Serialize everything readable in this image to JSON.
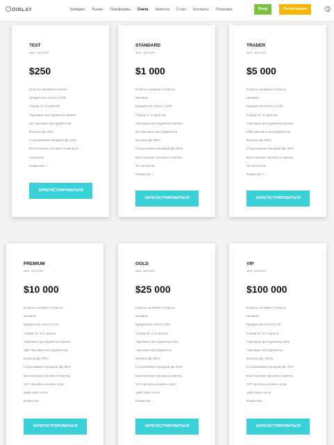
{
  "header": {
    "logo": "OINLAY",
    "nav": [
      "Трейдинг",
      "Рынки",
      "Платформы",
      "Счета",
      "Новости",
      "О нас",
      "Контакты",
      "Политика"
    ],
    "login": "Вход",
    "register": "Регистрация"
  },
  "plans": [
    {
      "name": "TEST",
      "sub": "мин. депозит",
      "price": "$250",
      "features": [
        "Классы активов 9 валют",
        "Кредитное плечо 1:200",
        "Спред от 3 пунктов",
        "Торговые инструменты Более",
        "25 торговых инструментов",
        "Бонусы До 20%",
        "Страхование вкладов До 10%",
        "Бесплатные сигналы в месяц 5",
        "сигналов",
        "Комиссия +"
      ],
      "cta": "ЗАРЕГИСТРИРОВАТЬСЯ"
    },
    {
      "name": "STANDARD",
      "sub": "мин. депозит",
      "price": "$1 000",
      "features": [
        "Классы активов 4 класса",
        "активов",
        "Кредитное плечо 1:200",
        "Спред от 3 пунктов",
        "Торговые инструменты Более",
        "50 торговых инструментов",
        "Бонусы До 35%",
        "Страхование вкладов До 35%",
        "Бесплатные сигналы в месяц",
        "10 сигналов",
        "Комиссия +"
      ],
      "cta": "ЗАРЕГИСТРИРОВАТЬСЯ"
    },
    {
      "name": "TRADER",
      "sub": "мин. депозит",
      "price": "$5 000",
      "features": [
        "Классы активов 4 класса",
        "активов",
        "Кредитное плечо 1:100",
        "Спред От 3 пунктов",
        "Торговые инструменты Более",
        "100 торговых инструментов",
        "Бонусы До 50%",
        "Страхование вкладов До 40%",
        "Бесплатные сигналы в месяц",
        "15 сигналов",
        "Комиссия +"
      ],
      "cta": "ЗАРЕГИСТРИРОВАТЬСЯ"
    },
    {
      "name": "PREMIUM",
      "sub": "мин. депозит",
      "price": "$10 000",
      "features": [
        "Классы активов 4 класса",
        "активов",
        "Кредитное плечо 1:75",
        "Спред От 2.1 пункта",
        "Торговые инструменты Более",
        "250 торговых инструментов",
        "Бонусы До 70%",
        "Страхование вкладов До 55%",
        "Бесплатные сигналы в месяц",
        "VIP сигналы на весь срок",
        "действия счета",
        "Комиссия -"
      ],
      "cta": "ЗАРЕГИСТРИРОВАТЬСЯ"
    },
    {
      "name": "GOLD",
      "sub": "мин. депозит",
      "price": "$25 000",
      "features": [
        "Классы активов 4 класса",
        "активов",
        "Кредитное плечо 1:50",
        "Спред От 1.5 пункта",
        "Торговые инструменты Все",
        "торговые инструменты",
        "Бонусы До 85%",
        "Страхование вкладов До 65%",
        "Бесплатные сигналы в месяц",
        "VIP сигналы на весь срок",
        "действия счета",
        "Комиссия -"
      ],
      "cta": "ЗАРЕГИСТРИРОВАТЬСЯ"
    },
    {
      "name": "VIP",
      "sub": "мин. депозит",
      "price": "$100 000",
      "features": [
        "Классы активов 4 класса",
        "активов",
        "Кредитное плечо 1:30",
        "Спред От 0.7 пункта",
        "Торговые инструменты Все",
        "торговые инструменты",
        "Бонусы До 100%",
        "Страхование вкладов До 75%",
        "Бесплатные сигналы в месяц",
        "VIP сигналы на весь срок",
        "действия счета",
        "Комиссия -"
      ],
      "cta": "ЗАРЕГИСТРИРОВАТЬСЯ"
    }
  ]
}
